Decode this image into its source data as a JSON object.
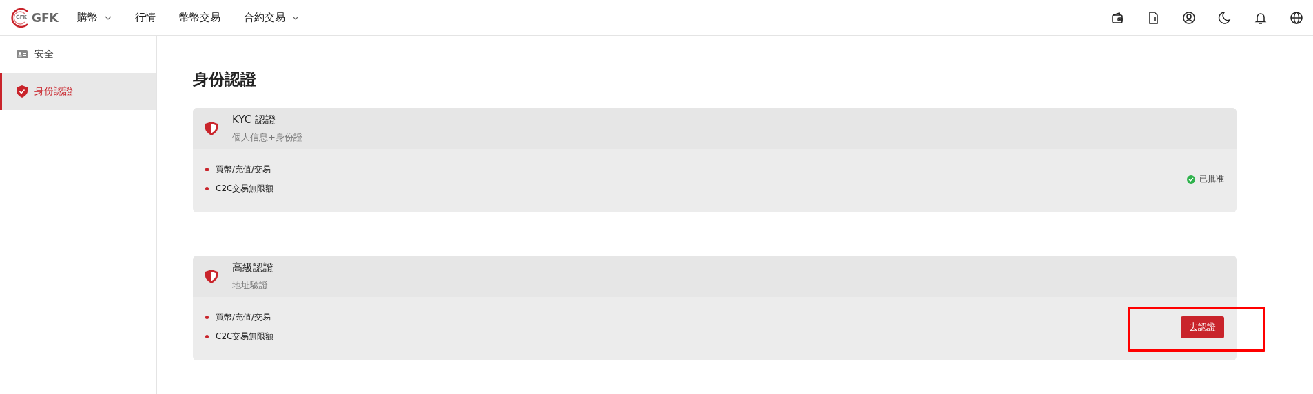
{
  "header": {
    "logo": {
      "mark_text": "GFK",
      "name": "GFK"
    },
    "nav": [
      {
        "label": "購幣",
        "dropdown": true
      },
      {
        "label": "行情",
        "dropdown": false
      },
      {
        "label": "幣幣交易",
        "dropdown": false
      },
      {
        "label": "合約交易",
        "dropdown": true
      }
    ]
  },
  "sidebar": {
    "items": [
      {
        "label": "安全",
        "kind": "id-card",
        "selected": false
      },
      {
        "label": "身份認證",
        "kind": "shield",
        "selected": true
      }
    ]
  },
  "page_title": "身份認證",
  "cards": [
    {
      "title": "KYC 認證",
      "subtitle": "個人信息+身份證",
      "features": [
        "買幣/充值/交易",
        "C2C交易無限額"
      ],
      "action": {
        "kind": "status",
        "label": "已批准"
      },
      "highlighted": false
    },
    {
      "title": "高級認證",
      "subtitle": "地址驗證",
      "features": [
        "買幣/充值/交易",
        "C2C交易無限額"
      ],
      "action": {
        "kind": "button",
        "label": "去認證"
      },
      "highlighted": true
    }
  ]
}
